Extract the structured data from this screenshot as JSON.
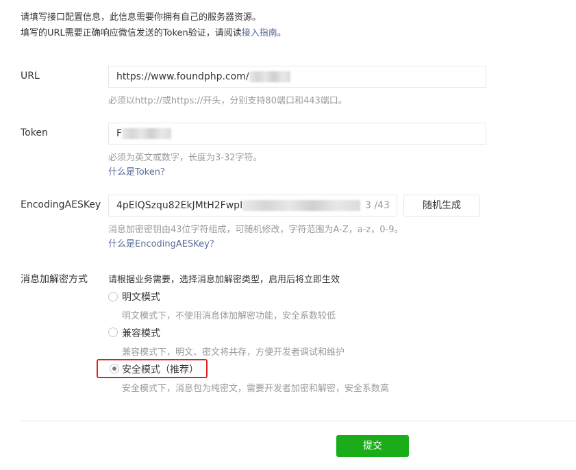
{
  "intro": {
    "line1": "请填写接口配置信息，此信息需要你拥有自己的服务器资源。",
    "line2_prefix": "填写的URL需要正确响应微信发送的Token验证，请阅读",
    "line2_link": "接入指南",
    "line2_suffix": "。"
  },
  "url": {
    "label": "URL",
    "value": "https://www.foundphp.com/",
    "hint": "必须以http://或https://开头，分别支持80端口和443端口。"
  },
  "token": {
    "label": "Token",
    "value": "F",
    "hint": "必须为英文或数字，长度为3-32字符。",
    "help_link": "什么是Token？"
  },
  "aes": {
    "label": "EncodingAESKey",
    "value": "4pEIQSzqu82EkJMtH2FwpI",
    "counter_tail": "3 /43",
    "generate_button": "随机生成",
    "hint": "消息加密密钥由43位字符组成，可随机修改，字符范围为A-Z，a-z，0-9。",
    "help_link": "什么是EncodingAESKey？"
  },
  "encryption": {
    "label": "消息加解密方式",
    "description": "请根据业务需要，选择消息加解密类型，启用后将立即生效",
    "options": [
      {
        "label": "明文模式",
        "desc": "明文模式下，不使用消息体加解密功能，安全系数较低",
        "checked": false
      },
      {
        "label": "兼容模式",
        "desc": "兼容模式下，明文、密文将共存，方便开发者调试和维护",
        "checked": false
      },
      {
        "label": "安全模式（推荐）",
        "desc": "安全模式下，消息包为纯密文，需要开发者加密和解密，安全系数高",
        "checked": true
      }
    ]
  },
  "submit_button": "提交",
  "colors": {
    "primary": "#1aad19",
    "link": "#576b95",
    "highlight_border": "#e0201c",
    "hint_text": "#9a9a9a"
  }
}
